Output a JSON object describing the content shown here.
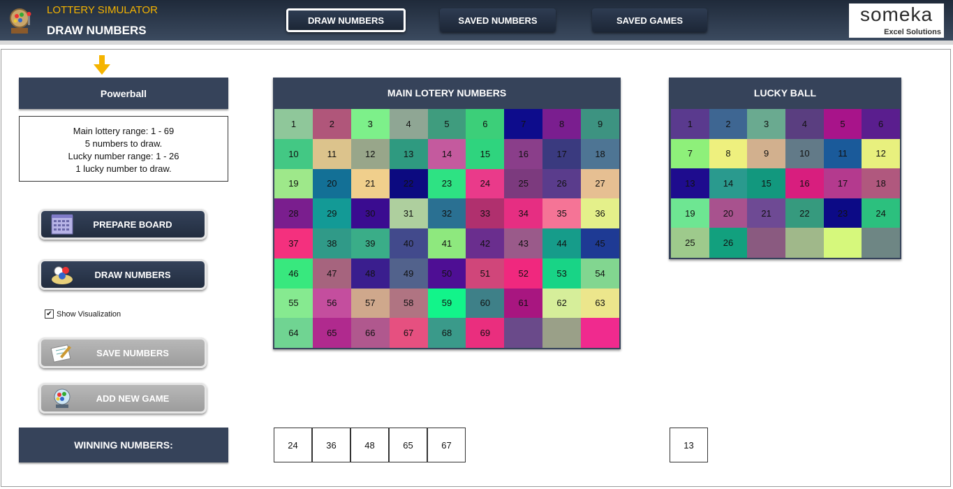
{
  "header": {
    "app_name": "LOTTERY SIMULATOR",
    "page_title": "DRAW NUMBERS",
    "nav": [
      {
        "label": "DRAW NUMBERS",
        "active": true
      },
      {
        "label": "SAVED NUMBERS",
        "active": false
      },
      {
        "label": "SAVED GAMES",
        "active": false
      }
    ],
    "brand": {
      "name": "someka",
      "tagline": "Excel Solutions"
    }
  },
  "left": {
    "game": "Powerball",
    "info": [
      "Main lottery range: 1 - 69",
      "5 numbers to draw.",
      "Lucky number range: 1 - 26",
      "1 lucky number to draw."
    ],
    "buttons": {
      "prepare": "PREPARE BOARD",
      "draw": "DRAW NUMBERS",
      "save": "SAVE NUMBERS",
      "add_game": "ADD NEW GAME"
    },
    "show_visualization": {
      "label": "Show Visualization",
      "checked": true
    },
    "winning_label": "WINNING NUMBERS:"
  },
  "main_board": {
    "title": "MAIN LOTERY NUMBERS",
    "cells": [
      {
        "n": "1",
        "c": "#8fc79a"
      },
      {
        "n": "2",
        "c": "#b0567a"
      },
      {
        "n": "3",
        "c": "#7df08a"
      },
      {
        "n": "4",
        "c": "#8fa694"
      },
      {
        "n": "5",
        "c": "#3f9c7e"
      },
      {
        "n": "6",
        "c": "#3ccf79"
      },
      {
        "n": "7",
        "c": "#0d0c8c"
      },
      {
        "n": "8",
        "c": "#7a1e8f"
      },
      {
        "n": "9",
        "c": "#3d9381"
      },
      {
        "n": "10",
        "c": "#43c884"
      },
      {
        "n": "11",
        "c": "#dcc38c"
      },
      {
        "n": "12",
        "c": "#98a68a"
      },
      {
        "n": "13",
        "c": "#2f9a80"
      },
      {
        "n": "14",
        "c": "#c45a9e"
      },
      {
        "n": "15",
        "c": "#2fd47e"
      },
      {
        "n": "16",
        "c": "#8a3e8a"
      },
      {
        "n": "17",
        "c": "#3a3a7f"
      },
      {
        "n": "18",
        "c": "#4e7594"
      },
      {
        "n": "19",
        "c": "#9ee88a"
      },
      {
        "n": "20",
        "c": "#137096"
      },
      {
        "n": "21",
        "c": "#f0cf8c"
      },
      {
        "n": "22",
        "c": "#0c0a80"
      },
      {
        "n": "23",
        "c": "#2ee283"
      },
      {
        "n": "24",
        "c": "#ea3a8a"
      },
      {
        "n": "25",
        "c": "#7c3a7e"
      },
      {
        "n": "26",
        "c": "#5a3c8c"
      },
      {
        "n": "27",
        "c": "#e6bf92"
      },
      {
        "n": "28",
        "c": "#7a1e8e"
      },
      {
        "n": "29",
        "c": "#139a96"
      },
      {
        "n": "30",
        "c": "#3a0c90"
      },
      {
        "n": "31",
        "c": "#aecf9e"
      },
      {
        "n": "32",
        "c": "#2a7092"
      },
      {
        "n": "33",
        "c": "#b0306e"
      },
      {
        "n": "34",
        "c": "#e62e82"
      },
      {
        "n": "35",
        "c": "#f57496"
      },
      {
        "n": "36",
        "c": "#e4f08a"
      },
      {
        "n": "37",
        "c": "#f4307e"
      },
      {
        "n": "38",
        "c": "#309a88"
      },
      {
        "n": "39",
        "c": "#3aad88"
      },
      {
        "n": "40",
        "c": "#424a8c"
      },
      {
        "n": "41",
        "c": "#8ee87e"
      },
      {
        "n": "42",
        "c": "#6a2e8e"
      },
      {
        "n": "43",
        "c": "#9a5a8a"
      },
      {
        "n": "44",
        "c": "#169c8a"
      },
      {
        "n": "45",
        "c": "#1e3a94"
      },
      {
        "n": "46",
        "c": "#38e87e"
      },
      {
        "n": "47",
        "c": "#a6647e"
      },
      {
        "n": "48",
        "c": "#3a1e8e"
      },
      {
        "n": "49",
        "c": "#52628c"
      },
      {
        "n": "50",
        "c": "#4e0e94"
      },
      {
        "n": "51",
        "c": "#d0467a"
      },
      {
        "n": "52",
        "c": "#f0287e"
      },
      {
        "n": "53",
        "c": "#18d486"
      },
      {
        "n": "54",
        "c": "#82d690"
      },
      {
        "n": "55",
        "c": "#86ea90"
      },
      {
        "n": "56",
        "c": "#c44e9e"
      },
      {
        "n": "57",
        "c": "#cfa88c"
      },
      {
        "n": "58",
        "c": "#b07482"
      },
      {
        "n": "59",
        "c": "#12f48a"
      },
      {
        "n": "60",
        "c": "#3e8088"
      },
      {
        "n": "61",
        "c": "#a81680"
      },
      {
        "n": "62",
        "c": "#d6ee9a"
      },
      {
        "n": "63",
        "c": "#ece68c"
      },
      {
        "n": "64",
        "c": "#70d492"
      },
      {
        "n": "65",
        "c": "#b02a8e"
      },
      {
        "n": "66",
        "c": "#b0588e"
      },
      {
        "n": "67",
        "c": "#e65080"
      },
      {
        "n": "68",
        "c": "#3a9a8a"
      },
      {
        "n": "69",
        "c": "#ea2e7e"
      },
      {
        "n": "",
        "c": "#6a4a8a"
      },
      {
        "n": "",
        "c": "#9aa088"
      },
      {
        "n": "",
        "c": "#f02a8e"
      }
    ]
  },
  "lucky_board": {
    "title": "LUCKY BALL",
    "cells": [
      {
        "n": "1",
        "c": "#5a3a8e"
      },
      {
        "n": "2",
        "c": "#3e6692"
      },
      {
        "n": "3",
        "c": "#6aaa90"
      },
      {
        "n": "4",
        "c": "#5a3e80"
      },
      {
        "n": "5",
        "c": "#a8148a"
      },
      {
        "n": "6",
        "c": "#5a1e8e"
      },
      {
        "n": "7",
        "c": "#8ef07a"
      },
      {
        "n": "8",
        "c": "#eef07e"
      },
      {
        "n": "9",
        "c": "#d2b08e"
      },
      {
        "n": "10",
        "c": "#627a88"
      },
      {
        "n": "11",
        "c": "#1a5a9a"
      },
      {
        "n": "12",
        "c": "#e8f07e"
      },
      {
        "n": "13",
        "c": "#1e0c8e"
      },
      {
        "n": "14",
        "c": "#2a9a8e"
      },
      {
        "n": "15",
        "c": "#12987e"
      },
      {
        "n": "16",
        "c": "#d81e7e"
      },
      {
        "n": "17",
        "c": "#b43a8e"
      },
      {
        "n": "18",
        "c": "#b0587e"
      },
      {
        "n": "19",
        "c": "#6ee692"
      },
      {
        "n": "20",
        "c": "#a8528e"
      },
      {
        "n": "21",
        "c": "#6e4a94"
      },
      {
        "n": "22",
        "c": "#369a7e"
      },
      {
        "n": "23",
        "c": "#0c0a86"
      },
      {
        "n": "24",
        "c": "#2cc07e"
      },
      {
        "n": "25",
        "c": "#9eca8c"
      },
      {
        "n": "26",
        "c": "#12a07e"
      },
      {
        "n": "",
        "c": "#8a5a80"
      },
      {
        "n": "",
        "c": "#a0b88a"
      },
      {
        "n": "",
        "c": "#d6f87c"
      },
      {
        "n": "",
        "c": "#6e8684"
      }
    ]
  },
  "winning": {
    "main": [
      "24",
      "36",
      "48",
      "65",
      "67"
    ],
    "lucky": [
      "13"
    ]
  }
}
